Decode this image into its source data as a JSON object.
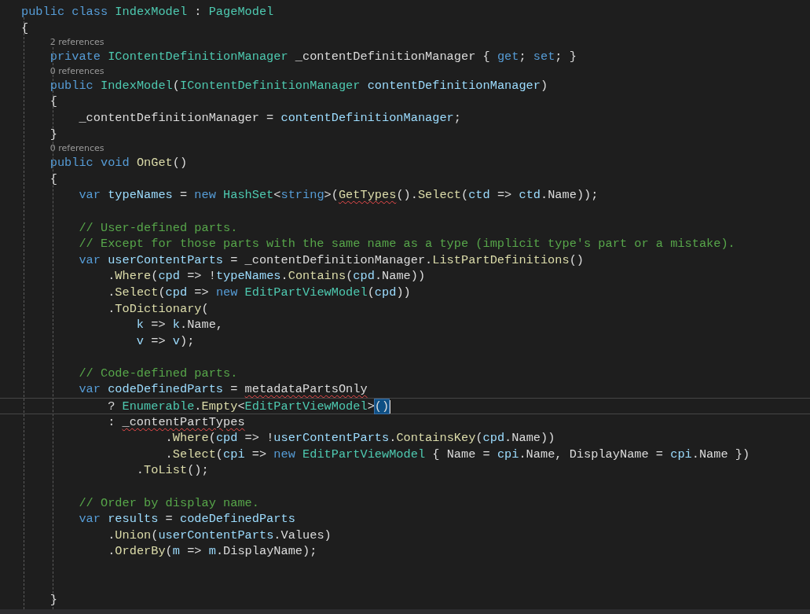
{
  "editor": {
    "lines": [
      {
        "kind": "code",
        "tokens": [
          {
            "t": "public class ",
            "kind": "kw"
          },
          {
            "t": "IndexModel",
            "kind": "type"
          },
          {
            "t": " : ",
            "kind": "plain"
          },
          {
            "t": "PageModel",
            "kind": "type"
          }
        ]
      },
      {
        "kind": "code",
        "tokens": [
          {
            "t": "{",
            "kind": "plain"
          }
        ]
      },
      {
        "kind": "lens",
        "text": "2 references"
      },
      {
        "kind": "code",
        "tokens": [
          {
            "t": "    private ",
            "kind": "kw"
          },
          {
            "t": "IContentDefinitionManager",
            "kind": "type"
          },
          {
            "t": " _contentDefinitionManager { ",
            "kind": "plain"
          },
          {
            "t": "get",
            "kind": "kw"
          },
          {
            "t": "; ",
            "kind": "plain"
          },
          {
            "t": "set",
            "kind": "kw"
          },
          {
            "t": "; }",
            "kind": "plain"
          }
        ]
      },
      {
        "kind": "lens",
        "text": "0 references"
      },
      {
        "kind": "code",
        "tokens": [
          {
            "t": "    public ",
            "kind": "kw"
          },
          {
            "t": "IndexModel",
            "kind": "type"
          },
          {
            "t": "(",
            "kind": "plain"
          },
          {
            "t": "IContentDefinitionManager",
            "kind": "type"
          },
          {
            "t": " contentDefinitionManager",
            "kind": "var"
          },
          {
            "t": ")",
            "kind": "plain"
          }
        ]
      },
      {
        "kind": "code",
        "tokens": [
          {
            "t": "    {",
            "kind": "plain"
          }
        ]
      },
      {
        "kind": "code",
        "tokens": [
          {
            "t": "        _contentDefinitionManager = ",
            "kind": "plain"
          },
          {
            "t": "contentDefinitionManager",
            "kind": "var"
          },
          {
            "t": ";",
            "kind": "plain"
          }
        ]
      },
      {
        "kind": "code",
        "tokens": [
          {
            "t": "    }",
            "kind": "plain"
          }
        ]
      },
      {
        "kind": "lens",
        "text": "0 references"
      },
      {
        "kind": "code",
        "tokens": [
          {
            "t": "    public void ",
            "kind": "kw"
          },
          {
            "t": "OnGet",
            "kind": "method"
          },
          {
            "t": "()",
            "kind": "plain"
          }
        ]
      },
      {
        "kind": "code",
        "tokens": [
          {
            "t": "    {",
            "kind": "plain"
          }
        ]
      },
      {
        "kind": "code",
        "tokens": [
          {
            "t": "        var ",
            "kind": "kw"
          },
          {
            "t": "typeNames",
            "kind": "var"
          },
          {
            "t": " = ",
            "kind": "plain"
          },
          {
            "t": "new ",
            "kind": "kw"
          },
          {
            "t": "HashSet",
            "kind": "type"
          },
          {
            "t": "<",
            "kind": "plain"
          },
          {
            "t": "string",
            "kind": "kw"
          },
          {
            "t": ">(",
            "kind": "plain"
          },
          {
            "t": "GetTypes",
            "kind": "method",
            "squiggle": true
          },
          {
            "t": "().",
            "kind": "plain"
          },
          {
            "t": "Select",
            "kind": "method"
          },
          {
            "t": "(",
            "kind": "plain"
          },
          {
            "t": "ctd",
            "kind": "var"
          },
          {
            "t": " => ",
            "kind": "plain"
          },
          {
            "t": "ctd",
            "kind": "var"
          },
          {
            "t": ".Name));",
            "kind": "plain"
          }
        ]
      },
      {
        "kind": "blank"
      },
      {
        "kind": "code",
        "tokens": [
          {
            "t": "        // User-defined parts.",
            "kind": "comment"
          }
        ]
      },
      {
        "kind": "code",
        "tokens": [
          {
            "t": "        // Except for those parts with the same name as a type (implicit type's part or a mistake).",
            "kind": "comment"
          }
        ]
      },
      {
        "kind": "code",
        "tokens": [
          {
            "t": "        var ",
            "kind": "kw"
          },
          {
            "t": "userContentParts",
            "kind": "var"
          },
          {
            "t": " = _contentDefinitionManager.",
            "kind": "plain"
          },
          {
            "t": "ListPartDefinitions",
            "kind": "method"
          },
          {
            "t": "()",
            "kind": "plain"
          }
        ]
      },
      {
        "kind": "code",
        "tokens": [
          {
            "t": "            .",
            "kind": "plain"
          },
          {
            "t": "Where",
            "kind": "method"
          },
          {
            "t": "(",
            "kind": "plain"
          },
          {
            "t": "cpd",
            "kind": "var"
          },
          {
            "t": " => !",
            "kind": "plain"
          },
          {
            "t": "typeNames",
            "kind": "var"
          },
          {
            "t": ".",
            "kind": "plain"
          },
          {
            "t": "Contains",
            "kind": "method"
          },
          {
            "t": "(",
            "kind": "plain"
          },
          {
            "t": "cpd",
            "kind": "var"
          },
          {
            "t": ".Name))",
            "kind": "plain"
          }
        ]
      },
      {
        "kind": "code",
        "tokens": [
          {
            "t": "            .",
            "kind": "plain"
          },
          {
            "t": "Select",
            "kind": "method"
          },
          {
            "t": "(",
            "kind": "plain"
          },
          {
            "t": "cpd",
            "kind": "var"
          },
          {
            "t": " => ",
            "kind": "plain"
          },
          {
            "t": "new ",
            "kind": "kw"
          },
          {
            "t": "EditPartViewModel",
            "kind": "type"
          },
          {
            "t": "(",
            "kind": "plain"
          },
          {
            "t": "cpd",
            "kind": "var"
          },
          {
            "t": "))",
            "kind": "plain"
          }
        ]
      },
      {
        "kind": "code",
        "tokens": [
          {
            "t": "            .",
            "kind": "plain"
          },
          {
            "t": "ToDictionary",
            "kind": "method"
          },
          {
            "t": "(",
            "kind": "plain"
          }
        ]
      },
      {
        "kind": "code",
        "tokens": [
          {
            "t": "                k",
            "kind": "var"
          },
          {
            "t": " => ",
            "kind": "plain"
          },
          {
            "t": "k",
            "kind": "var"
          },
          {
            "t": ".Name,",
            "kind": "plain"
          }
        ]
      },
      {
        "kind": "code",
        "tokens": [
          {
            "t": "                v",
            "kind": "var"
          },
          {
            "t": " => ",
            "kind": "plain"
          },
          {
            "t": "v",
            "kind": "var"
          },
          {
            "t": ");",
            "kind": "plain"
          }
        ]
      },
      {
        "kind": "blank"
      },
      {
        "kind": "code",
        "tokens": [
          {
            "t": "        // Code-defined parts.",
            "kind": "comment"
          }
        ]
      },
      {
        "kind": "code",
        "tokens": [
          {
            "t": "        var ",
            "kind": "kw"
          },
          {
            "t": "codeDefinedParts",
            "kind": "var"
          },
          {
            "t": " = ",
            "kind": "plain"
          },
          {
            "t": "metadataPartsOnly",
            "kind": "plain",
            "squiggle": true
          }
        ]
      },
      {
        "kind": "code",
        "current": true,
        "tokens": [
          {
            "t": "            ? ",
            "kind": "plain"
          },
          {
            "t": "Enumerable",
            "kind": "type"
          },
          {
            "t": ".",
            "kind": "plain"
          },
          {
            "t": "Empty",
            "kind": "method"
          },
          {
            "t": "<",
            "kind": "plain"
          },
          {
            "t": "EditPartViewModel",
            "kind": "type"
          },
          {
            "t": ">",
            "kind": "plain"
          },
          {
            "t": "()",
            "kind": "plain",
            "bracket_match": true
          }
        ]
      },
      {
        "kind": "code",
        "tokens": [
          {
            "t": "            : ",
            "kind": "plain"
          },
          {
            "t": "_contentPartTypes",
            "kind": "plain",
            "squiggle": true
          }
        ]
      },
      {
        "kind": "code",
        "tokens": [
          {
            "t": "                    .",
            "kind": "plain"
          },
          {
            "t": "Where",
            "kind": "method"
          },
          {
            "t": "(",
            "kind": "plain"
          },
          {
            "t": "cpd",
            "kind": "var"
          },
          {
            "t": " => !",
            "kind": "plain"
          },
          {
            "t": "userContentParts",
            "kind": "var"
          },
          {
            "t": ".",
            "kind": "plain"
          },
          {
            "t": "ContainsKey",
            "kind": "method"
          },
          {
            "t": "(",
            "kind": "plain"
          },
          {
            "t": "cpd",
            "kind": "var"
          },
          {
            "t": ".Name))",
            "kind": "plain"
          }
        ]
      },
      {
        "kind": "code",
        "tokens": [
          {
            "t": "                    .",
            "kind": "plain"
          },
          {
            "t": "Select",
            "kind": "method"
          },
          {
            "t": "(",
            "kind": "plain"
          },
          {
            "t": "cpi",
            "kind": "var"
          },
          {
            "t": " => ",
            "kind": "plain"
          },
          {
            "t": "new ",
            "kind": "kw"
          },
          {
            "t": "EditPartViewModel",
            "kind": "type"
          },
          {
            "t": " { Name = ",
            "kind": "plain"
          },
          {
            "t": "cpi",
            "kind": "var"
          },
          {
            "t": ".Name, DisplayName = ",
            "kind": "plain"
          },
          {
            "t": "cpi",
            "kind": "var"
          },
          {
            "t": ".Name })",
            "kind": "plain"
          }
        ]
      },
      {
        "kind": "code",
        "tokens": [
          {
            "t": "                .",
            "kind": "plain"
          },
          {
            "t": "ToList",
            "kind": "method"
          },
          {
            "t": "();",
            "kind": "plain"
          }
        ]
      },
      {
        "kind": "blank"
      },
      {
        "kind": "code",
        "tokens": [
          {
            "t": "        // Order by display name.",
            "kind": "comment"
          }
        ]
      },
      {
        "kind": "code",
        "tokens": [
          {
            "t": "        var ",
            "kind": "kw"
          },
          {
            "t": "results",
            "kind": "var"
          },
          {
            "t": " = ",
            "kind": "plain"
          },
          {
            "t": "codeDefinedParts",
            "kind": "var"
          }
        ]
      },
      {
        "kind": "code",
        "tokens": [
          {
            "t": "            .",
            "kind": "plain"
          },
          {
            "t": "Union",
            "kind": "method"
          },
          {
            "t": "(",
            "kind": "plain"
          },
          {
            "t": "userContentParts",
            "kind": "var"
          },
          {
            "t": ".Values)",
            "kind": "plain"
          }
        ]
      },
      {
        "kind": "code",
        "tokens": [
          {
            "t": "            .",
            "kind": "plain"
          },
          {
            "t": "OrderBy",
            "kind": "method"
          },
          {
            "t": "(",
            "kind": "plain"
          },
          {
            "t": "m",
            "kind": "var"
          },
          {
            "t": " => ",
            "kind": "plain"
          },
          {
            "t": "m",
            "kind": "var"
          },
          {
            "t": ".DisplayName);",
            "kind": "plain"
          }
        ]
      },
      {
        "kind": "blank"
      },
      {
        "kind": "blank"
      },
      {
        "kind": "code",
        "tokens": [
          {
            "t": "    }",
            "kind": "plain"
          }
        ]
      }
    ]
  }
}
